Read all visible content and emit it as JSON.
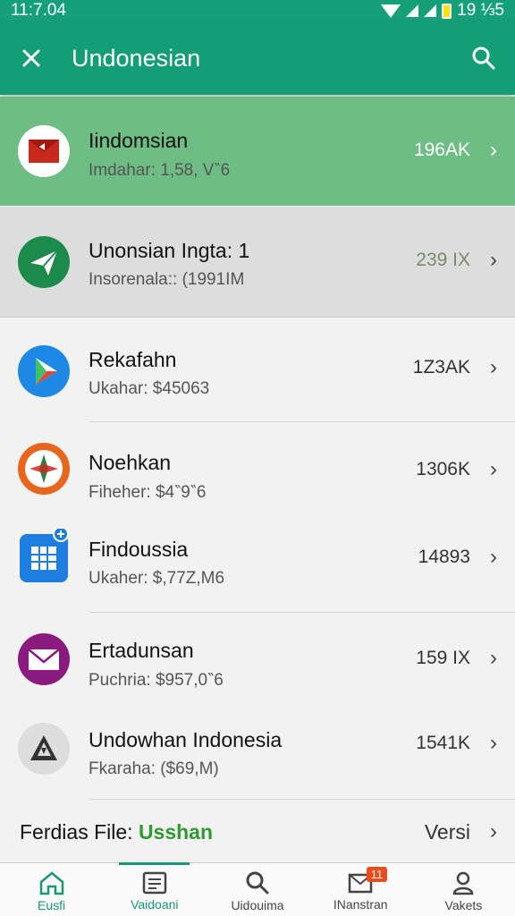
{
  "status_bar": {
    "time": "11:7.04",
    "clock": "19 ⅓5"
  },
  "app_bar": {
    "title": "Undonesian"
  },
  "rows": [
    {
      "title": "Iindomsian",
      "subtitle": "Imdahar: 1,58, V‶6",
      "size": "196AK",
      "icon": "flag-envelope-icon",
      "color": "#ffffff"
    },
    {
      "title": "Unonsian Ingta: 1",
      "subtitle": "Insorenala:: (1991IM",
      "size": "239 IX",
      "icon": "paper-plane-icon",
      "color": "#1c8a4a"
    },
    {
      "title": "Rekafahn",
      "subtitle": "Ukahar: $45063",
      "size": "1Z3AK",
      "icon": "play-store-icon",
      "color": "#1e88e5"
    },
    {
      "title": "Noehkan",
      "subtitle": "Fiheher: $4‶9‶6",
      "size": "1306K",
      "icon": "compass-icon",
      "color": "#e8651e"
    },
    {
      "title": "Findoussia",
      "subtitle": "Ukaher: $,77Z,M6",
      "size": "14893",
      "icon": "spreadsheet-icon",
      "color": "#1e7ee0"
    },
    {
      "title": "Ertadunsan",
      "subtitle": "Puchria: $957,0‶6",
      "size": "159 IX",
      "icon": "mail-icon",
      "color": "#8a1a7e"
    },
    {
      "title": "Undowhan Indonesia",
      "subtitle": "Fkaraha: ($69,M)",
      "size": "1541K",
      "icon": "warning-triangle-icon",
      "color": "#dddddd"
    }
  ],
  "footer": {
    "label": "Ferdias File:",
    "accent": "Usshan",
    "right": "Versi"
  },
  "bottom_nav": [
    {
      "label": "Eusfi",
      "icon": "home-icon"
    },
    {
      "label": "Vaidoani",
      "icon": "list-icon"
    },
    {
      "label": "Uidouima",
      "icon": "search-icon"
    },
    {
      "label": "INanstran",
      "icon": "inbox-icon",
      "badge": "11"
    },
    {
      "label": "Vakets",
      "icon": "profile-icon"
    }
  ],
  "colors": {
    "primary": "#139e76",
    "highlight_row": "#6dbd85",
    "accent_text": "#2f9a2f",
    "badge": "#ee4b1b"
  }
}
